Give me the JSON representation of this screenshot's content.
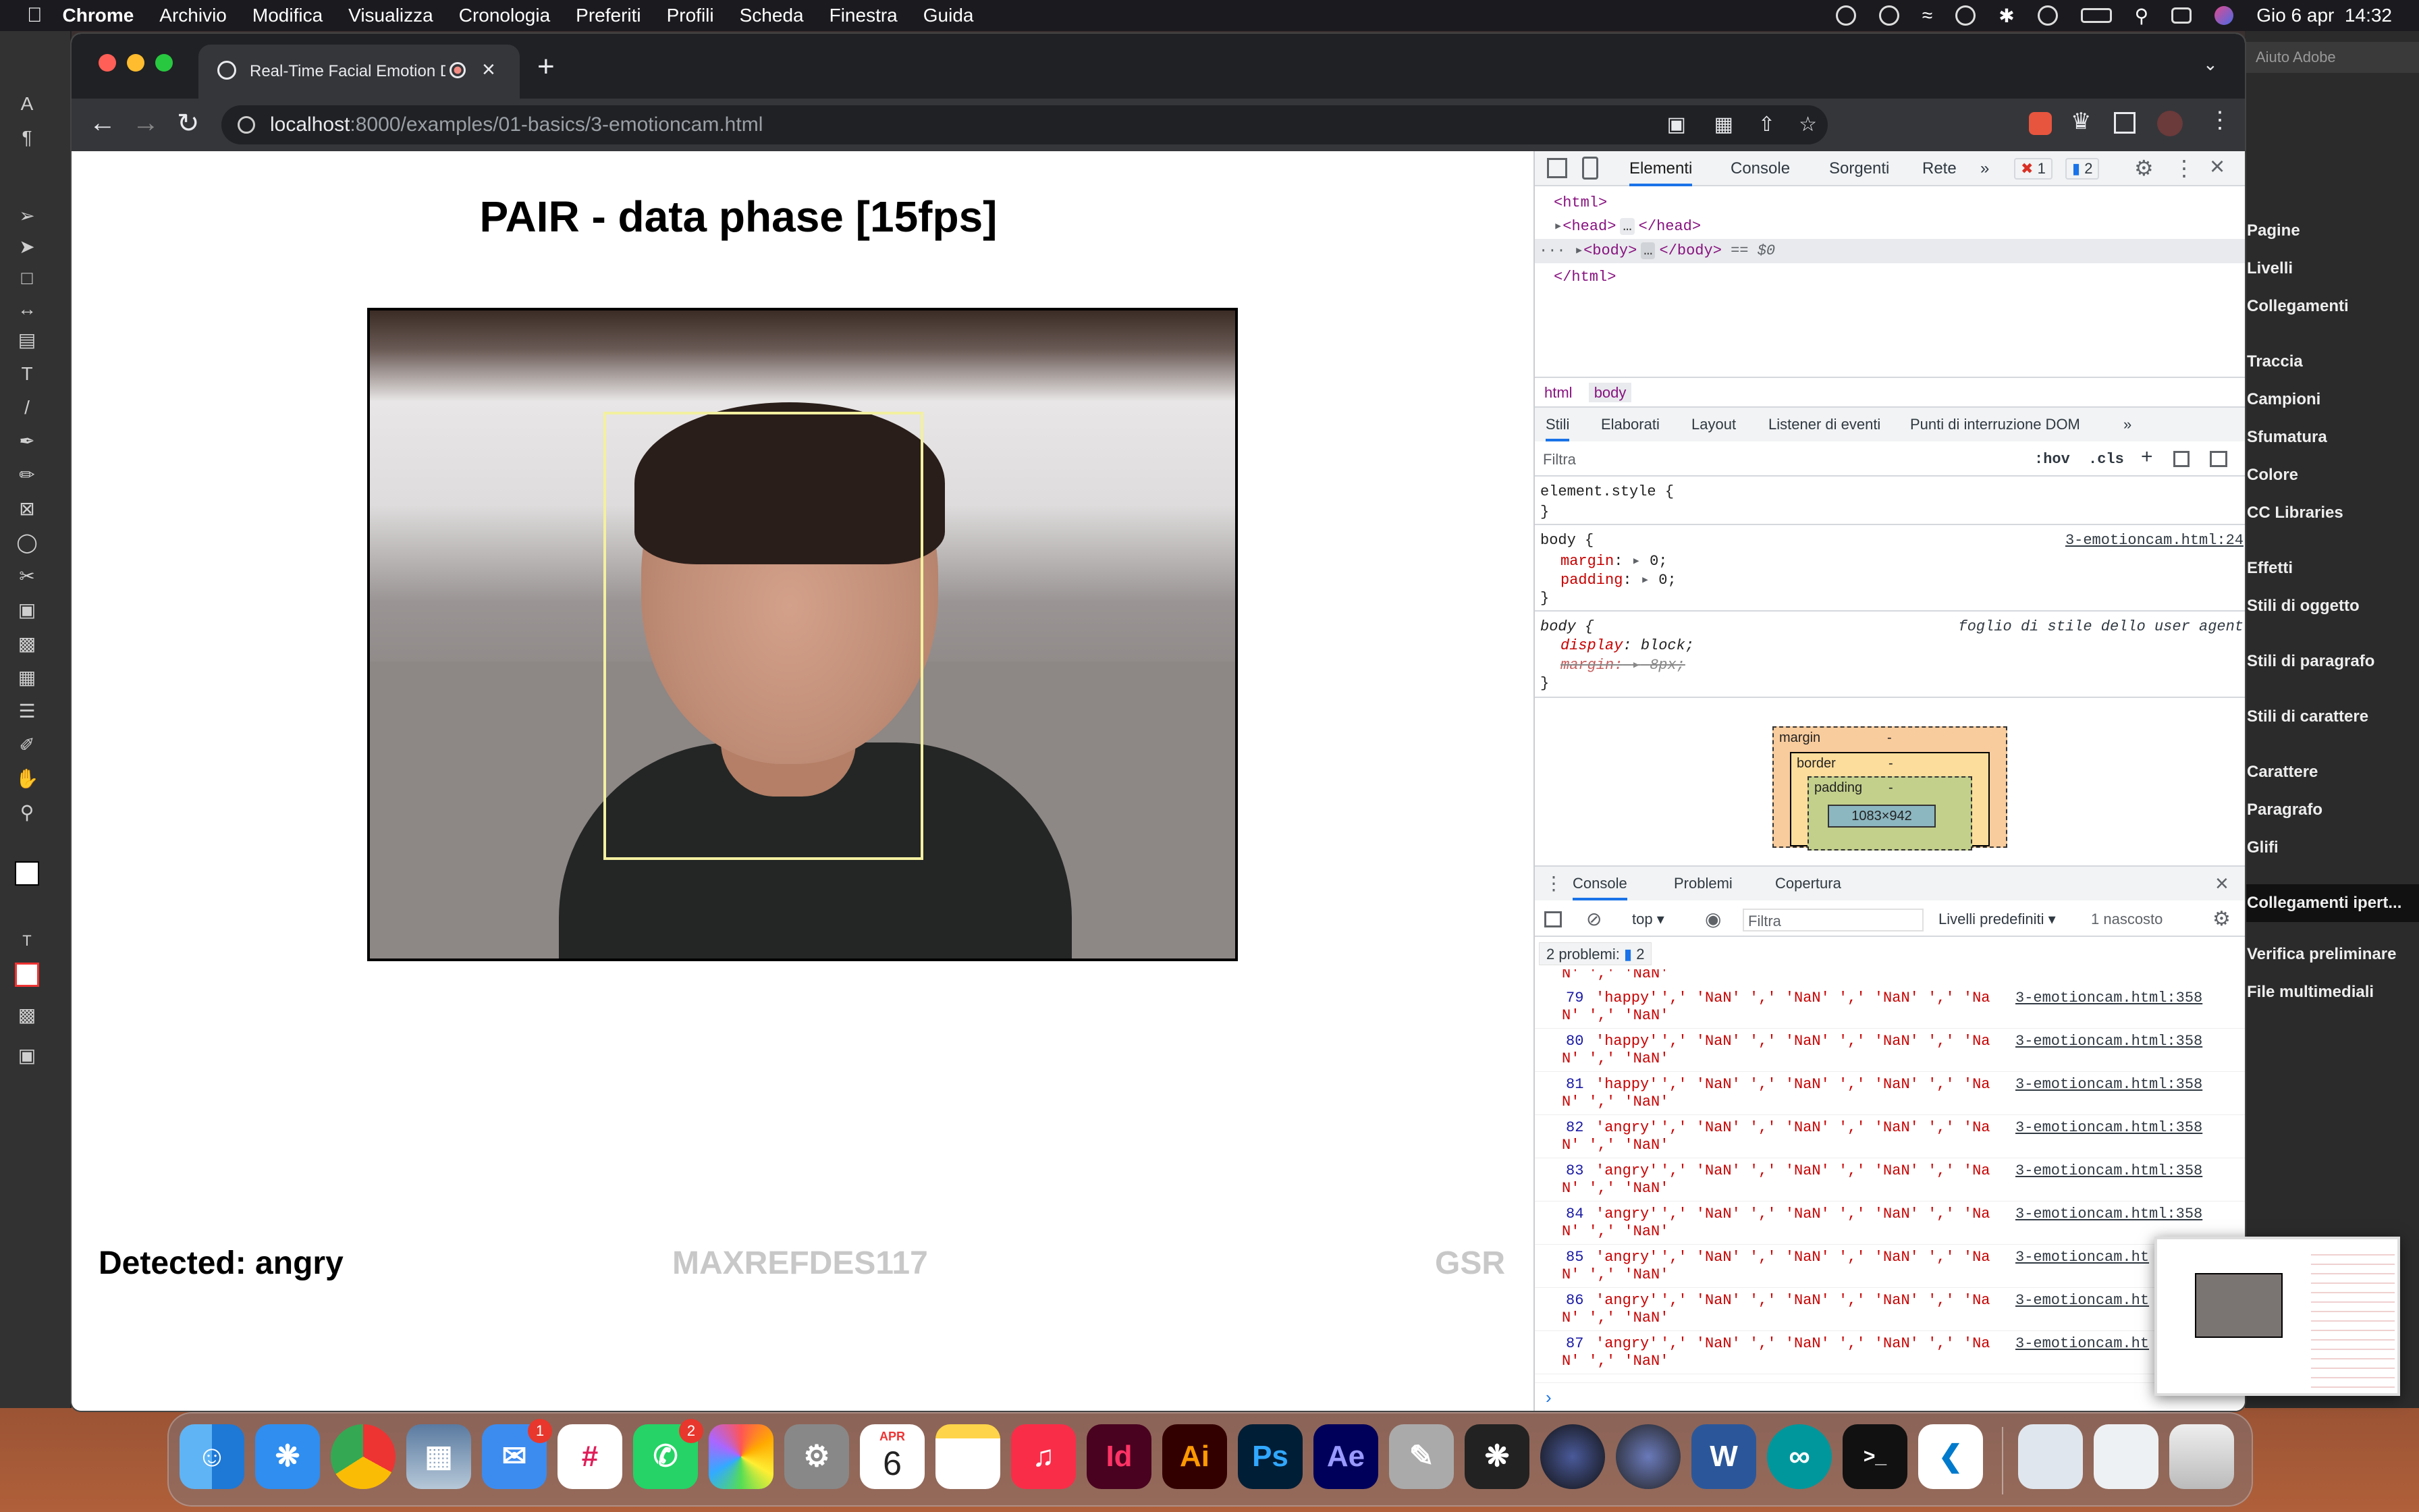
{
  "menubar": {
    "apple": "",
    "app": "Chrome",
    "items": [
      "Archivio",
      "Modifica",
      "Visualizza",
      "Cronologia",
      "Preferiti",
      "Profili",
      "Scheda",
      "Finestra",
      "Guida"
    ],
    "datetime": "Gio 6 apr  14:32"
  },
  "illustrator": {
    "search_placeholder": "Aiuto Adobe",
    "panels": [
      "Pagine",
      "Livelli",
      "Collegamenti",
      "Traccia",
      "Campioni",
      "Sfumatura",
      "Colore",
      "CC Libraries",
      "Effetti",
      "Stili di oggetto",
      "Stili di paragrafo",
      "Stili di carattere",
      "Carattere",
      "Paragrafo",
      "Glifi",
      "Collegamenti ipert...",
      "Verifica preliminare",
      "File multimediali"
    ]
  },
  "chrome": {
    "tab_title": "Real-Time Facial Emotion D",
    "url_host": "localhost",
    "url_path": ":8000/examples/01-basics/3-emotioncam.html"
  },
  "page": {
    "title": "PAIR - data phase [15fps]",
    "detected": "Detected: angry",
    "sensor1": "MAXREFDES117",
    "sensor2": "GSR"
  },
  "devtools": {
    "tabs": [
      "Elementi",
      "Console",
      "Sorgenti",
      "Rete"
    ],
    "errors": "1",
    "messages": "2",
    "dom": {
      "l1": "<html>",
      "l2": "<head>",
      "l2b": "</head>",
      "l3": "<body>",
      "l3b": "</body>",
      "l3c": "== $0",
      "l4": "</html>"
    },
    "breadcrumbs": [
      "html",
      "body"
    ],
    "style_tabs": [
      "Stili",
      "Elaborati",
      "Layout",
      "Listener di eventi",
      "Punti di interruzione DOM"
    ],
    "filter_placeholder": "Filtra",
    "hov": ":hov",
    "cls": ".cls",
    "rules": {
      "element_style": "element.style {",
      "close": "}",
      "body_sel": "body {",
      "body_src": "3-emotioncam.html:24",
      "margin": "margin",
      "margin_val": "0;",
      "padding": "padding",
      "padding_val": "0;",
      "ua_sel": "body {",
      "ua_src": "foglio di stile dello user agent",
      "display": "display",
      "display_val": "block;",
      "ua_margin": "margin:",
      "ua_margin_val": "8px;"
    },
    "boxmodel": {
      "margin": "margin",
      "border": "border",
      "padding": "padding",
      "size": "1083×942",
      "dash": "-"
    },
    "console": {
      "drawer_tabs": [
        "Console",
        "Problemi",
        "Copertura"
      ],
      "context": "top",
      "filter_placeholder": "Filtra",
      "levels": "Livelli predefiniti",
      "hidden": "1 nascosto",
      "problems": "2 problemi:",
      "problems_count": "2",
      "rows": [
        {
          "n": "79",
          "emo": "happy",
          "src": "3-emotioncam.html:358"
        },
        {
          "n": "80",
          "emo": "happy",
          "src": "3-emotioncam.html:358"
        },
        {
          "n": "81",
          "emo": "happy",
          "src": "3-emotioncam.html:358"
        },
        {
          "n": "82",
          "emo": "angry",
          "src": "3-emotioncam.html:358"
        },
        {
          "n": "83",
          "emo": "angry",
          "src": "3-emotioncam.html:358"
        },
        {
          "n": "84",
          "emo": "angry",
          "src": "3-emotioncam.html:358"
        },
        {
          "n": "85",
          "emo": "angry",
          "src": "3-emotioncam.ht"
        },
        {
          "n": "86",
          "emo": "angry",
          "src": "3-emotioncam.ht"
        },
        {
          "n": "87",
          "emo": "angry",
          "src": "3-emotioncam.ht"
        }
      ],
      "row_tail": "',' 'NaN' ',' 'NaN' ',' 'NaN' ',' 'Na",
      "row_wrap": "N' ',' 'NaN'"
    }
  },
  "dock": {
    "mail_badge": "1",
    "whatsapp_badge": "2",
    "calendar_month": "APR",
    "calendar_day": "6",
    "apps": [
      "Id",
      "Ai",
      "Ps",
      "Ae"
    ]
  },
  "colors": {
    "face_box": "#f3f0a0",
    "console_text": "#c80000",
    "devtools_blue": "#1a73e8"
  }
}
